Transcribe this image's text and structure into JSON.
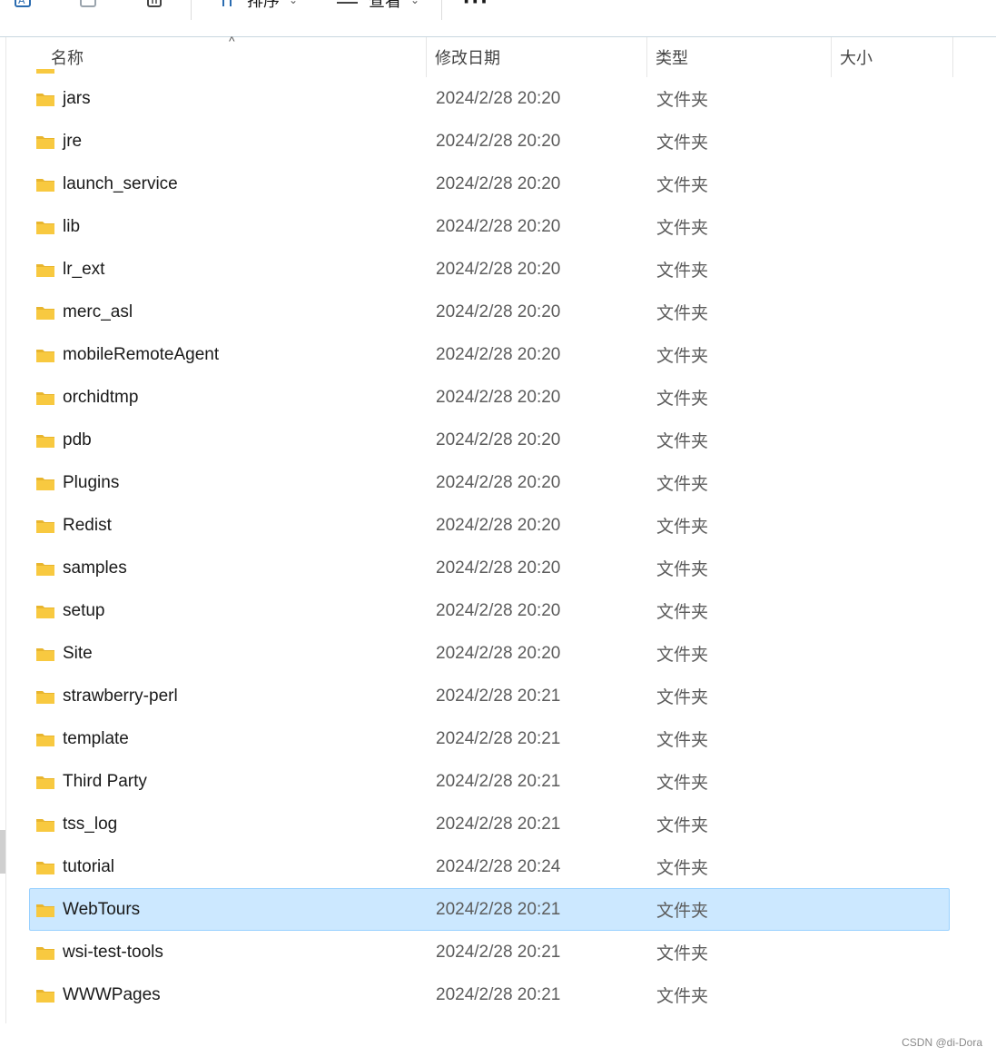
{
  "toolbar": {
    "sort_label": "排序",
    "view_label": "查看",
    "more_label": "···"
  },
  "columns": {
    "name": "名称",
    "modified": "修改日期",
    "type": "类型",
    "size": "大小"
  },
  "files": [
    {
      "name": "jars",
      "modified": "2024/2/28 20:20",
      "type": "文件夹"
    },
    {
      "name": "jre",
      "modified": "2024/2/28 20:20",
      "type": "文件夹"
    },
    {
      "name": "launch_service",
      "modified": "2024/2/28 20:20",
      "type": "文件夹"
    },
    {
      "name": "lib",
      "modified": "2024/2/28 20:20",
      "type": "文件夹"
    },
    {
      "name": "lr_ext",
      "modified": "2024/2/28 20:20",
      "type": "文件夹"
    },
    {
      "name": "merc_asl",
      "modified": "2024/2/28 20:20",
      "type": "文件夹"
    },
    {
      "name": "mobileRemoteAgent",
      "modified": "2024/2/28 20:20",
      "type": "文件夹"
    },
    {
      "name": "orchidtmp",
      "modified": "2024/2/28 20:20",
      "type": "文件夹"
    },
    {
      "name": "pdb",
      "modified": "2024/2/28 20:20",
      "type": "文件夹"
    },
    {
      "name": "Plugins",
      "modified": "2024/2/28 20:20",
      "type": "文件夹"
    },
    {
      "name": "Redist",
      "modified": "2024/2/28 20:20",
      "type": "文件夹"
    },
    {
      "name": "samples",
      "modified": "2024/2/28 20:20",
      "type": "文件夹"
    },
    {
      "name": "setup",
      "modified": "2024/2/28 20:20",
      "type": "文件夹"
    },
    {
      "name": "Site",
      "modified": "2024/2/28 20:20",
      "type": "文件夹"
    },
    {
      "name": "strawberry-perl",
      "modified": "2024/2/28 20:21",
      "type": "文件夹"
    },
    {
      "name": "template",
      "modified": "2024/2/28 20:21",
      "type": "文件夹"
    },
    {
      "name": "Third Party",
      "modified": "2024/2/28 20:21",
      "type": "文件夹"
    },
    {
      "name": "tss_log",
      "modified": "2024/2/28 20:21",
      "type": "文件夹"
    },
    {
      "name": "tutorial",
      "modified": "2024/2/28 20:24",
      "type": "文件夹"
    },
    {
      "name": "WebTours",
      "modified": "2024/2/28 20:21",
      "type": "文件夹",
      "selected": true
    },
    {
      "name": "wsi-test-tools",
      "modified": "2024/2/28 20:21",
      "type": "文件夹"
    },
    {
      "name": "WWWPages",
      "modified": "2024/2/28 20:21",
      "type": "文件夹"
    }
  ],
  "watermark": "CSDN @di-Dora",
  "colors": {
    "selected_bg": "#cce8ff",
    "selected_border": "#99d1ff",
    "folder_yellow": "#f8c940"
  }
}
